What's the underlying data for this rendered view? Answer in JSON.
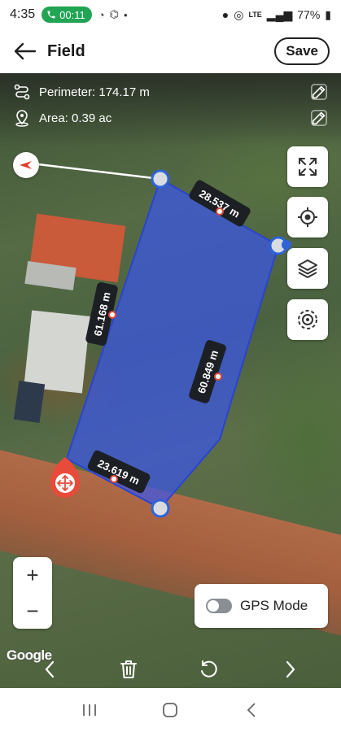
{
  "status_bar": {
    "time": "4:35",
    "call_timer": "00:11",
    "battery": "77%",
    "network": "LTE"
  },
  "header": {
    "title": "Field",
    "save_label": "Save"
  },
  "field_info": {
    "perimeter": "Perimeter: 174.17 m",
    "area": "Area: 0.39 ac"
  },
  "edges": [
    {
      "label": "28.537 m"
    },
    {
      "label": "61.168 m"
    },
    {
      "label": "60.849 m"
    },
    {
      "label": "23.619 m"
    }
  ],
  "map_controls": {
    "fullscreen_icon": "expand-icon",
    "locate_icon": "crosshair-icon",
    "layers_icon": "layers-icon",
    "gps_target_icon": "target-icon"
  },
  "zoom": {
    "in_label": "+",
    "out_label": "−"
  },
  "gps": {
    "label": "GPS Mode",
    "enabled": false
  },
  "attribution": "Google",
  "colors": {
    "field_fill": "#3a56e8",
    "vertex": "#2f63d9",
    "move_marker": "#e84b3a"
  }
}
